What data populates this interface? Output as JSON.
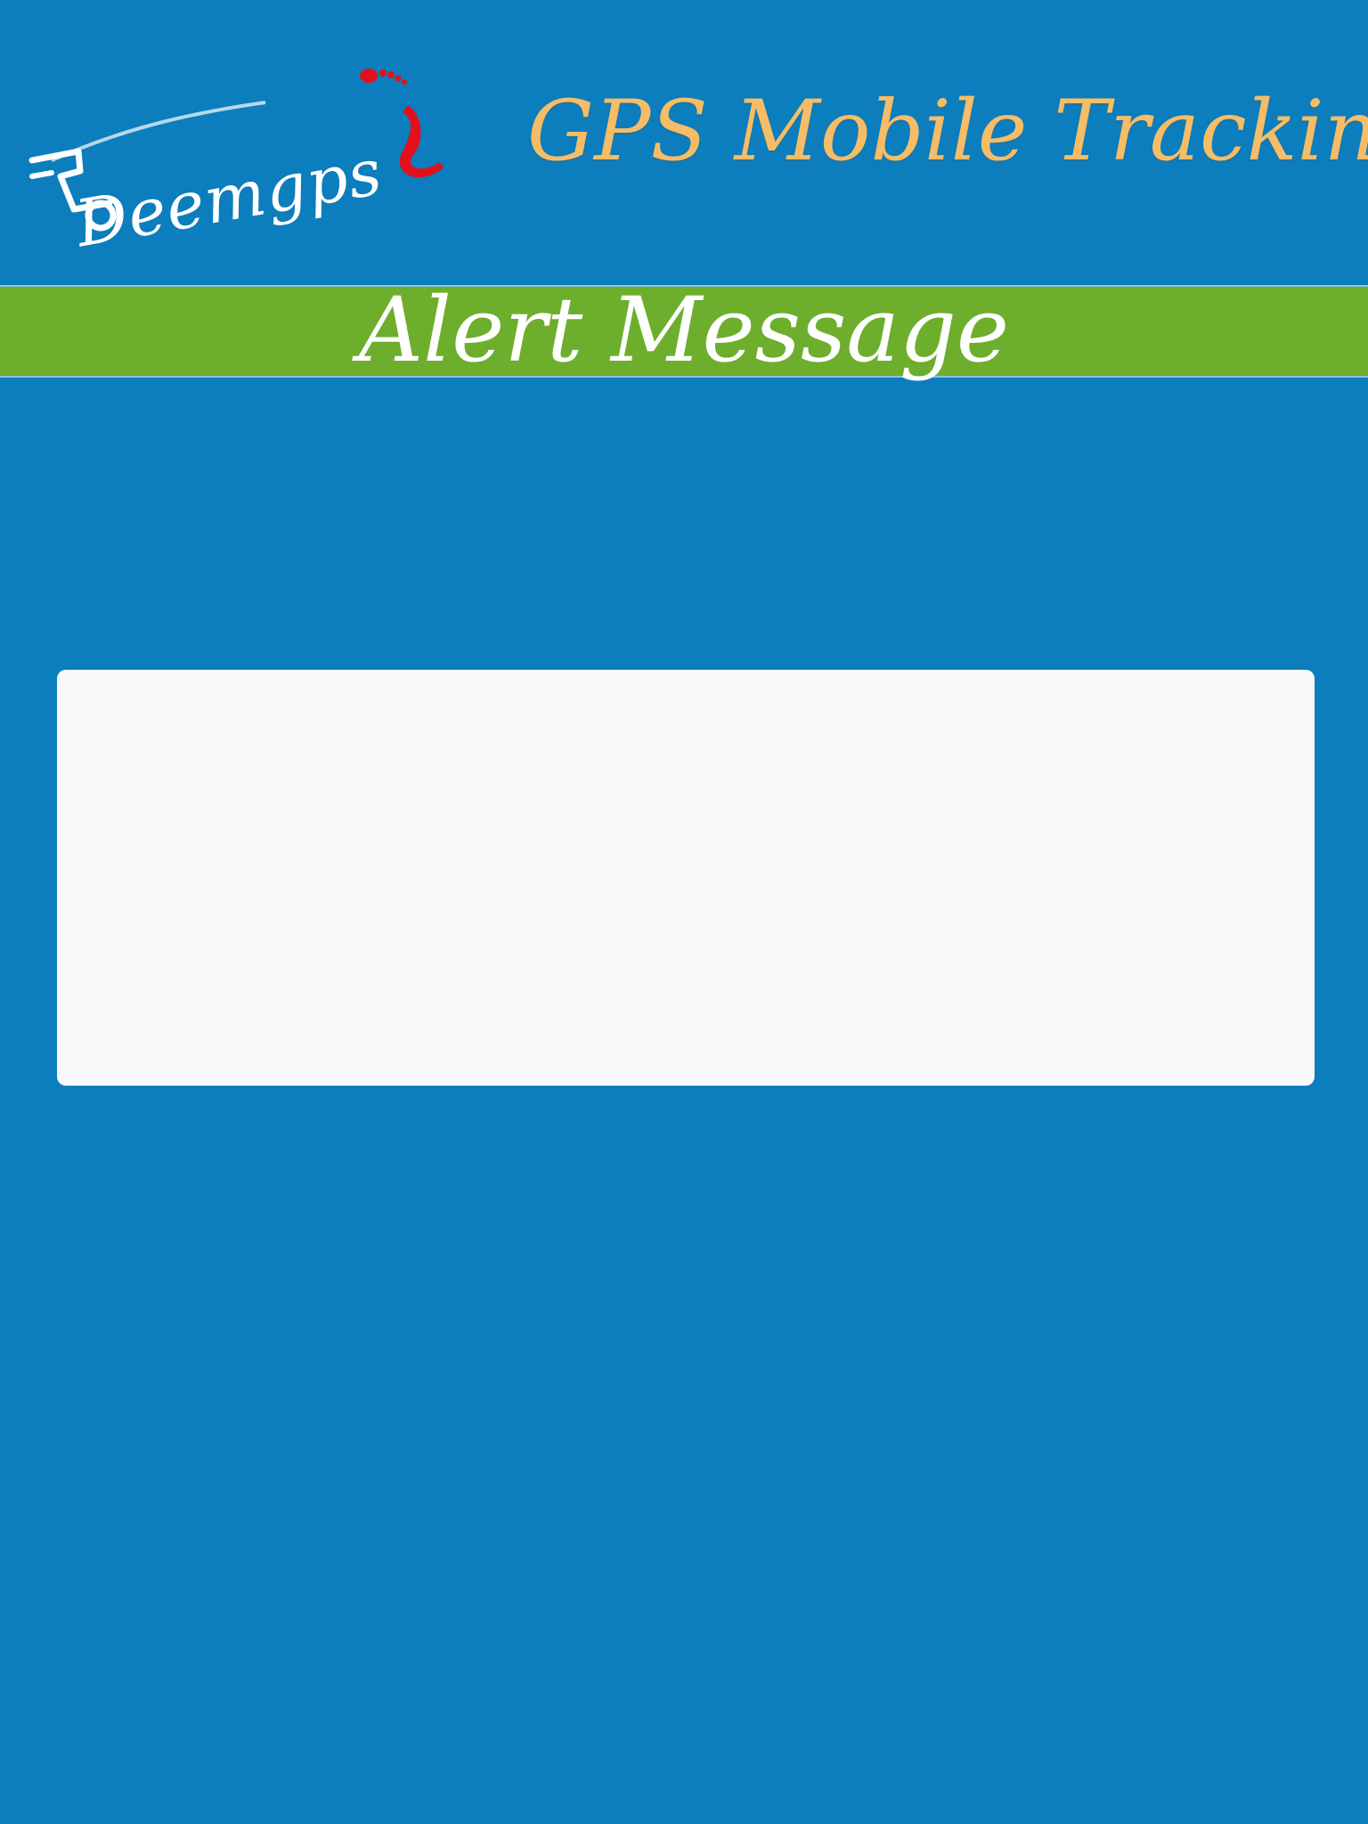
{
  "header": {
    "logo_text": "Deemgps",
    "app_title": "GPS Mobile Tracking"
  },
  "page": {
    "title": "Alert Message"
  },
  "alert": {
    "message": ""
  },
  "colors": {
    "background": "#0c7dbd",
    "title_bar": "#6dae2d",
    "app_title": "#f6bd66",
    "panel": "#f9f9f9",
    "logo_accent": "#e3101b"
  },
  "icons": {
    "logo": "deemgps-logo-car-footprints"
  }
}
